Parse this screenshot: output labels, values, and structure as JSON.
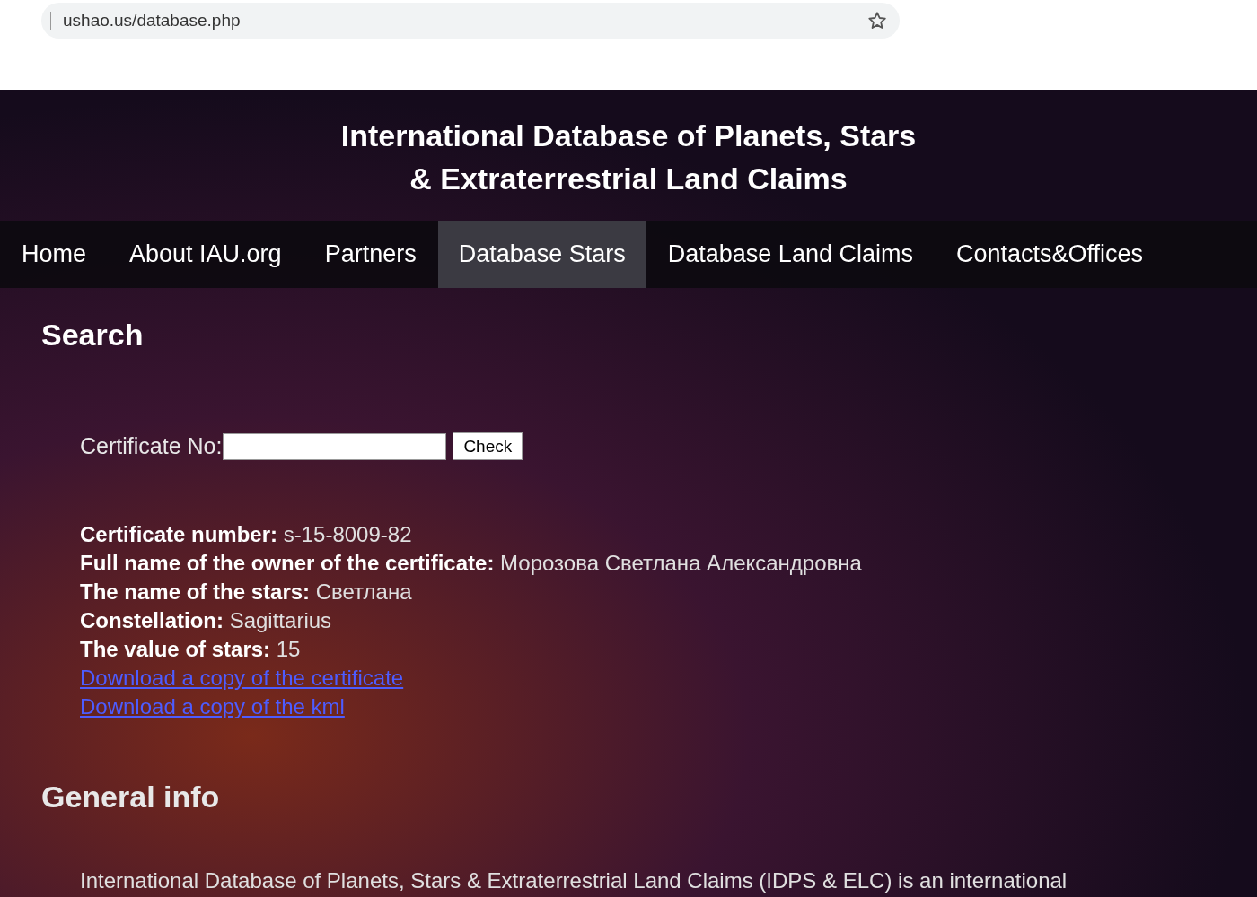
{
  "address_bar": {
    "url": "ushao.us/database.php"
  },
  "site_title": [
    "International Database of Planets, Stars",
    "& Extraterrestrial Land Claims"
  ],
  "nav": [
    {
      "label": "Home",
      "selected": false
    },
    {
      "label": "About IAU.org",
      "selected": false
    },
    {
      "label": "Partners",
      "selected": false
    },
    {
      "label": "Database Stars",
      "selected": true
    },
    {
      "label": "Database Land Claims",
      "selected": false
    },
    {
      "label": "Contacts&Offices",
      "selected": false
    }
  ],
  "search": {
    "heading": "Search",
    "label": "Certificate No:",
    "button": "Check"
  },
  "result": {
    "fields": [
      {
        "label": "Certificate number:",
        "value": "s-15-8009-82"
      },
      {
        "label": "Full name of the owner of the certificate:",
        "value": "Морозова Светлана Александровна"
      },
      {
        "label": "The name of the stars:",
        "value": "Светлана"
      },
      {
        "label": "Constellation:",
        "value": "Sagittarius"
      },
      {
        "label": "The value of stars:",
        "value": "15"
      }
    ],
    "links": [
      "Download a copy of the certificate",
      "Download a copy of the kml"
    ]
  },
  "general_info": {
    "heading": "General info",
    "text": "International Database of Planets, Stars & Extraterrestrial Land Claims (IDPS & ELC) is an international"
  }
}
